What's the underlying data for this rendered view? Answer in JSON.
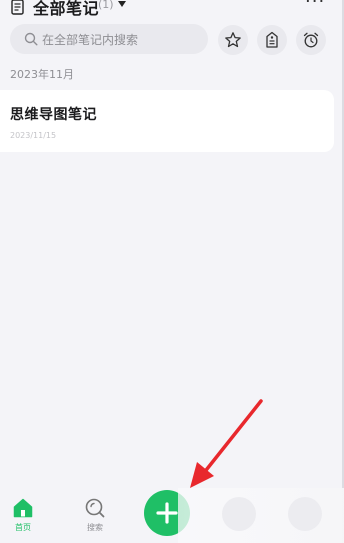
{
  "header": {
    "title": "全部笔记",
    "count": "(1)",
    "more_label": "···",
    "doc_icon": "note-document-icon",
    "caret_icon": "caret-down-icon"
  },
  "search": {
    "placeholder": "在全部笔记内搜索",
    "icon": "search-icon"
  },
  "toolbar_icons": [
    "star-icon",
    "tag-icon",
    "alarm-clock-icon"
  ],
  "section": {
    "month": "2023年11月"
  },
  "notes": [
    {
      "title": "思维导图笔记",
      "date": "2023/11/15"
    }
  ],
  "bottom_nav": {
    "items": [
      {
        "label": "首页",
        "icon": "home-icon",
        "active": true
      },
      {
        "label": "搜索",
        "icon": "search-nav-icon",
        "active": false
      }
    ],
    "fab_icon": "plus-icon"
  },
  "colors": {
    "accent": "#1fbf66",
    "background": "#f4f4f8",
    "card": "#ffffff",
    "annotation_arrow": "#e8282d"
  }
}
